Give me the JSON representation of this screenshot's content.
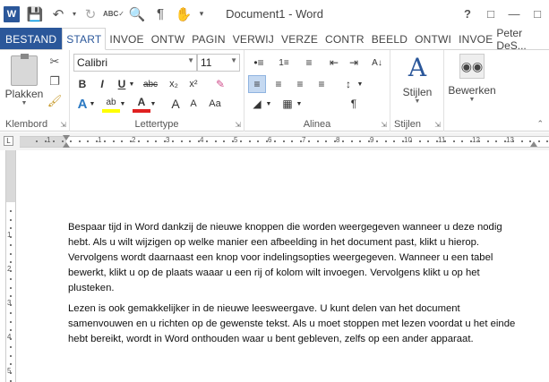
{
  "window": {
    "title": "Document1 - Word",
    "help": "?",
    "logo_letter": "W"
  },
  "qat": {
    "icons": [
      "word-logo",
      "save-icon",
      "undo-icon",
      "redo-icon",
      "spelling-icon",
      "print-preview-icon",
      "paragraph-marks-icon",
      "touch-mode-icon",
      "customize-icon"
    ]
  },
  "tabs": [
    {
      "label": "BESTAND",
      "kind": "file"
    },
    {
      "label": "START",
      "kind": "active"
    },
    {
      "label": "INVOE",
      "kind": "normal"
    },
    {
      "label": "ONTW",
      "kind": "normal"
    },
    {
      "label": "PAGIN",
      "kind": "normal"
    },
    {
      "label": "VERWIJ",
      "kind": "normal"
    },
    {
      "label": "VERZE",
      "kind": "normal"
    },
    {
      "label": "CONTR",
      "kind": "normal"
    },
    {
      "label": "BEELD",
      "kind": "normal"
    },
    {
      "label": "ONTWI",
      "kind": "normal"
    },
    {
      "label": "INVOE",
      "kind": "normal"
    }
  ],
  "user": "Peter DeS...",
  "ribbon": {
    "clipboard": {
      "label": "Klembord",
      "paste_label": "Plakken"
    },
    "font": {
      "label": "Lettertype",
      "font_name": "Calibri",
      "font_size": "11",
      "bold": "B",
      "italic": "I",
      "underline": "U",
      "strike": "abc",
      "subscript": "x₂",
      "superscript": "x²",
      "effects": "A",
      "highlight": "ab",
      "fontcolor": "A",
      "grow": "A",
      "shrink": "A",
      "case": "Aa"
    },
    "paragraph": {
      "label": "Alinea"
    },
    "styles": {
      "label": "Stijlen",
      "button_label": "Stijlen"
    },
    "editing": {
      "button_label": "Bewerken"
    }
  },
  "ruler": {
    "numbers": [
      "1",
      "1",
      "2",
      "3",
      "4",
      "5",
      "6",
      "7",
      "8",
      "9",
      "10",
      "11",
      "12",
      "13"
    ],
    "vnumbers": [
      "1",
      "2",
      "3",
      "4",
      "5"
    ]
  },
  "document": {
    "paragraphs": [
      "Bespaar tijd in Word dankzij de nieuwe knoppen die worden weergegeven wanneer u deze nodig hebt. Als u wilt wijzigen op welke manier een afbeelding in het document past, klikt u hierop. Vervolgens wordt daarnaast een knop voor indelingsopties weergegeven. Wanneer u een tabel bewerkt, klikt u op de plaats waaar u een rij of kolom wilt invoegen. Vervolgens klikt u op het plusteken.",
      "Lezen is ook gemakkelijker in de nieuwe leesweergave. U kunt delen van het document samenvouwen en u richten op de gewenste tekst. Als u moet stoppen met lezen voordat u het einde hebt bereikt, wordt in Word onthouden waar u bent gebleven, zelfs op een ander apparaat."
    ]
  }
}
